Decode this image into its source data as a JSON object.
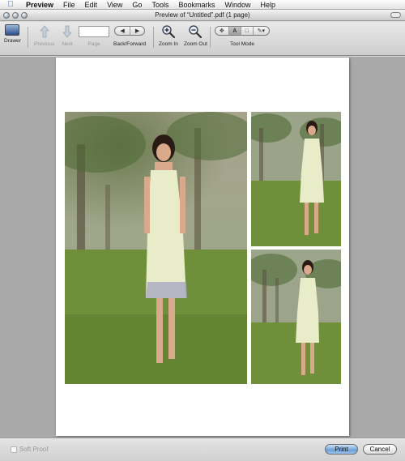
{
  "menubar": {
    "app_name": "Preview",
    "items": [
      "File",
      "Edit",
      "View",
      "Go",
      "Tools",
      "Bookmarks",
      "Window",
      "Help"
    ]
  },
  "window": {
    "title": "Preview of “Untitled”.pdf (1 page)"
  },
  "toolbar": {
    "drawer_label": "Drawer",
    "previous_label": "Previous",
    "next_label": "Next",
    "page_label": "Page",
    "page_value": "",
    "back_forward_label": "Back/Forward",
    "zoom_in_label": "Zoom In",
    "zoom_out_label": "Zoom Out",
    "tool_mode_label": "Tool Mode",
    "tool_mode_selected": "text-select"
  },
  "document": {
    "photos": [
      {
        "name": "main",
        "subject": "woman in sundress"
      },
      {
        "name": "top-right",
        "subject": "woman in sundress"
      },
      {
        "name": "bottom-right",
        "subject": "woman in sundress"
      }
    ]
  },
  "bottombar": {
    "soft_proof_label": "Soft Proof",
    "soft_proof_checked": false,
    "print_label": "Print",
    "cancel_label": "Cancel"
  },
  "colors": {
    "accent_print": "#6e9fd6",
    "doc_background": "#a9a9a9"
  }
}
